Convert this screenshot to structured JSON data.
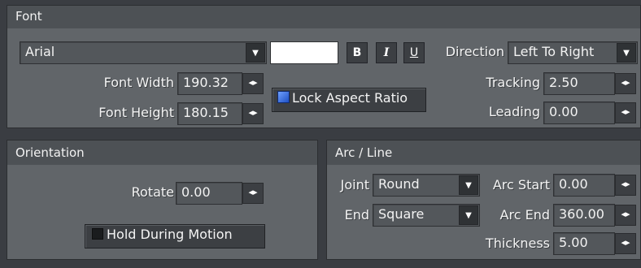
{
  "font": {
    "title": "Font",
    "family": "Arial",
    "bold_label": "B",
    "italic_label": "I",
    "underline_label": "U",
    "direction_label": "Direction",
    "direction_value": "Left To Right",
    "font_width_label": "Font Width",
    "font_width_value": "190.32",
    "font_height_label": "Font Height",
    "font_height_value": "180.15",
    "lock_aspect_label": "Lock Aspect Ratio",
    "tracking_label": "Tracking",
    "tracking_value": "2.50",
    "leading_label": "Leading",
    "leading_value": "0.00"
  },
  "orientation": {
    "title": "Orientation",
    "rotate_label": "Rotate",
    "rotate_value": "0.00",
    "hold_label": "Hold During Motion"
  },
  "arc_line": {
    "title": "Arc / Line",
    "joint_label": "Joint",
    "joint_value": "Round",
    "end_label": "End",
    "end_value": "Square",
    "arc_start_label": "Arc Start",
    "arc_start_value": "0.00",
    "arc_end_label": "Arc End",
    "arc_end_value": "360.00",
    "thickness_label": "Thickness",
    "thickness_value": "5.00"
  },
  "icons": {
    "spin": "◂▸",
    "dropdown": "▼"
  },
  "colors": {
    "panel_bg": "#616569",
    "header_bg": "#4d5155",
    "field_bg": "#53575b",
    "button_bg": "#3c3f43",
    "lock_checked": "#2a63d6",
    "swatch": "#ffffff"
  }
}
